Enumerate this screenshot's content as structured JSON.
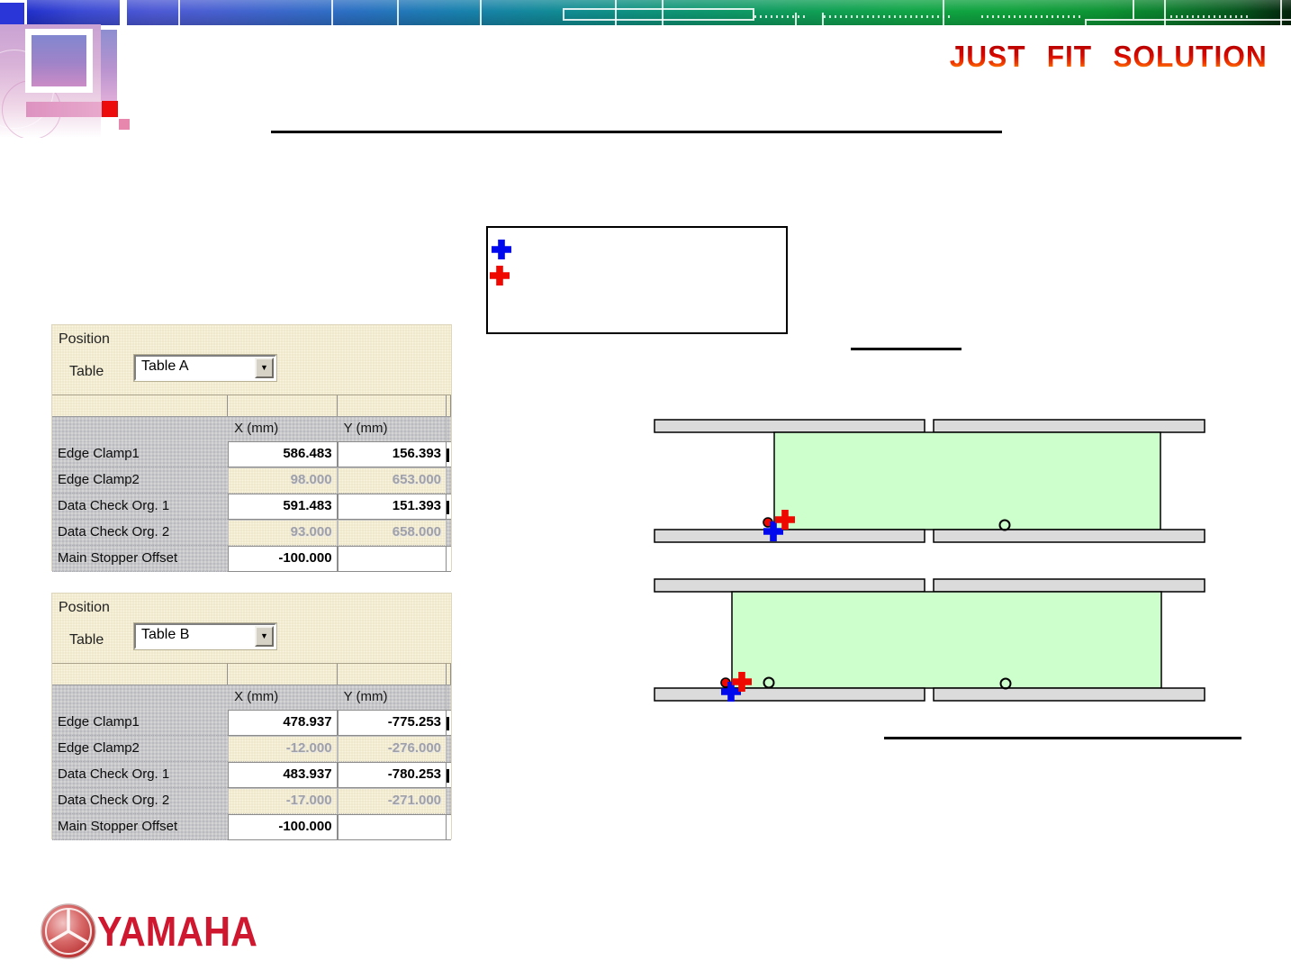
{
  "header": {
    "brand": "JUST FIT SOLUTION"
  },
  "legend": {
    "items": [
      {
        "name": "blue-cross-marker"
      },
      {
        "name": "red-cross-marker"
      }
    ]
  },
  "icons": {
    "dropdown_arrow": "▼"
  },
  "panels": [
    {
      "group_title": "Position",
      "field_label": "Table",
      "selected_value": "Table A",
      "columns": {
        "x": "X (mm)",
        "y": "Y (mm)"
      },
      "rows": [
        {
          "label": "Edge Clamp1",
          "x": "586.483",
          "y": "156.393"
        },
        {
          "label": "Edge Clamp2",
          "x": "98.000",
          "y": "653.000"
        },
        {
          "label": "Data Check Org. 1",
          "x": "591.483",
          "y": "151.393"
        },
        {
          "label": "Data Check Org. 2",
          "x": "93.000",
          "y": "658.000"
        },
        {
          "label": "Main Stopper Offset",
          "x": "-100.000",
          "y": ""
        }
      ]
    },
    {
      "group_title": "Position",
      "field_label": "Table",
      "selected_value": "Table B",
      "columns": {
        "x": "X (mm)",
        "y": "Y (mm)"
      },
      "rows": [
        {
          "label": "Edge Clamp1",
          "x": "478.937",
          "y": "-775.253"
        },
        {
          "label": "Edge Clamp2",
          "x": "-12.000",
          "y": "-276.000"
        },
        {
          "label": "Data Check Org. 1",
          "x": "483.937",
          "y": "-780.253"
        },
        {
          "label": "Data Check Org. 2",
          "x": "-17.000",
          "y": "-271.000"
        },
        {
          "label": "Main Stopper Offset",
          "x": "-100.000",
          "y": ""
        }
      ]
    }
  ],
  "footer": {
    "brand": "YAMAHA"
  },
  "colors": {
    "marker_blue": "#0008ee",
    "marker_red": "#ee0800",
    "table_fill": "#ccffcc",
    "rail_fill": "#dbdbdb",
    "brand_red": "#cf1830"
  }
}
